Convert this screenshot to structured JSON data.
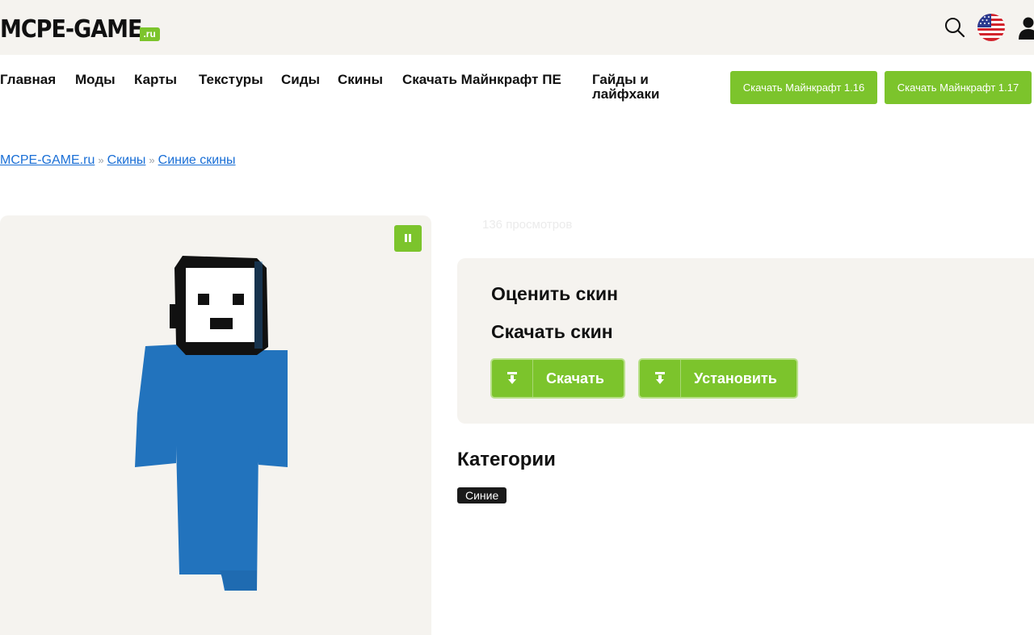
{
  "header": {
    "logo_text": "MCPE-GAME",
    "logo_tld": ".ru",
    "icons": [
      "search-icon",
      "us-flag-icon",
      "user-icon"
    ]
  },
  "nav": {
    "items": [
      {
        "label": "Главная"
      },
      {
        "label": "Моды"
      },
      {
        "label": "Карты"
      },
      {
        "label": "Текстуры"
      },
      {
        "label": "Сиды"
      },
      {
        "label": "Скины"
      },
      {
        "label": "Скачать Майнкрафт ПЕ"
      },
      {
        "label": "Гайды и лайфхаки"
      }
    ],
    "buttons": [
      {
        "label": "Скачать Майнкрафт 1.16"
      },
      {
        "label": "Скачать Майнкрафт 1.17"
      }
    ]
  },
  "breadcrumb": {
    "items": [
      "MCPE-GAME.ru",
      "Скины",
      "Синие скины"
    ],
    "separator": "»"
  },
  "preview": {
    "pause_icon": "pause-icon",
    "skin_colors": {
      "body": "#2273bd",
      "hair": "#111111",
      "face": "#ffffff"
    }
  },
  "stats": {
    "views": "136 просмотров"
  },
  "actions": {
    "rate_title": "Оценить скин",
    "download_title": "Скачать скин",
    "download_button": "Скачать",
    "install_button": "Установить"
  },
  "categories": {
    "title": "Категории",
    "tags": [
      "Синие"
    ]
  },
  "colors": {
    "accent": "#7cc42c",
    "link": "#1a6fd6",
    "panel_bg": "#f5f3ef"
  }
}
